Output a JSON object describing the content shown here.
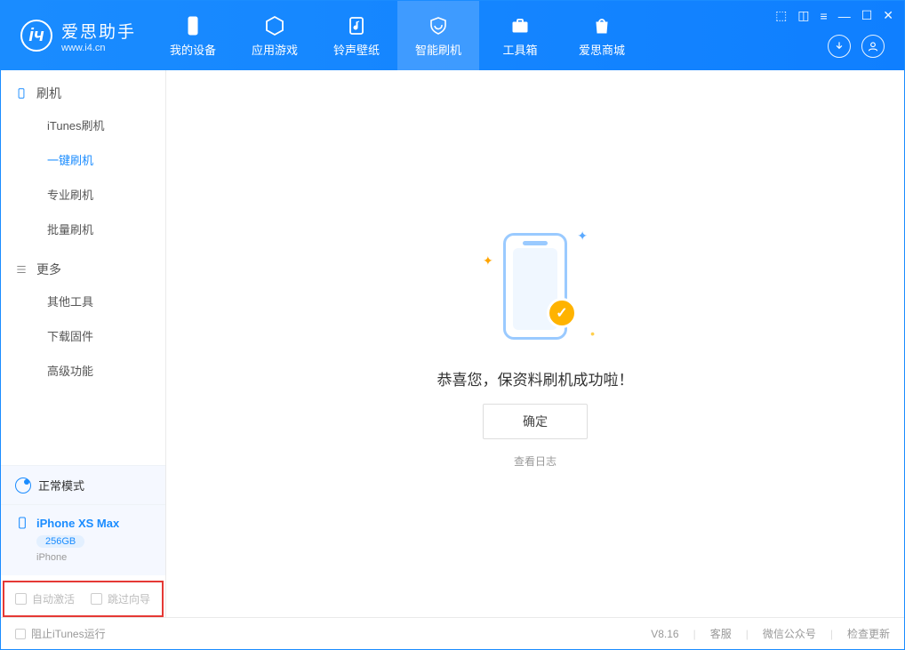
{
  "app": {
    "title": "爱思助手",
    "url": "www.i4.cn"
  },
  "nav": {
    "items": [
      {
        "label": "我的设备"
      },
      {
        "label": "应用游戏"
      },
      {
        "label": "铃声壁纸"
      },
      {
        "label": "智能刷机",
        "active": true
      },
      {
        "label": "工具箱"
      },
      {
        "label": "爱思商城"
      }
    ]
  },
  "sidebar": {
    "group1": {
      "title": "刷机",
      "items": [
        {
          "label": "iTunes刷机"
        },
        {
          "label": "一键刷机",
          "active": true
        },
        {
          "label": "专业刷机"
        },
        {
          "label": "批量刷机"
        }
      ]
    },
    "group2": {
      "title": "更多",
      "items": [
        {
          "label": "其他工具"
        },
        {
          "label": "下载固件"
        },
        {
          "label": "高级功能"
        }
      ]
    },
    "status": "正常模式",
    "device": {
      "name": "iPhone XS Max",
      "capacity": "256GB",
      "type": "iPhone"
    },
    "checks": {
      "auto_activate": "自动激活",
      "skip_guide": "跳过向导"
    }
  },
  "main": {
    "message": "恭喜您，保资料刷机成功啦！",
    "confirm": "确定",
    "view_log": "查看日志"
  },
  "footer": {
    "block_itunes": "阻止iTunes运行",
    "version": "V8.16",
    "support": "客服",
    "wechat": "微信公众号",
    "update": "检查更新"
  }
}
